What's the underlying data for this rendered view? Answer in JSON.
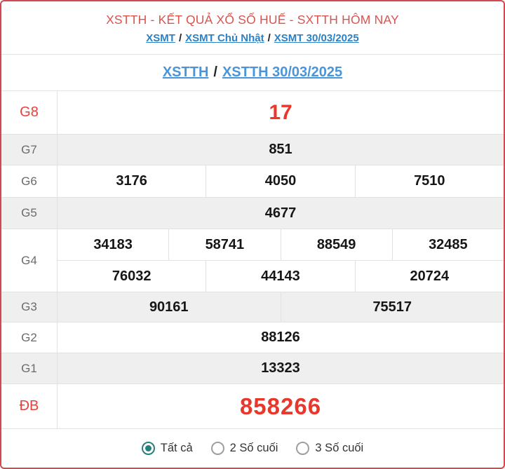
{
  "header": {
    "title": "XSTTH - KẾT QUẢ XỔ SỐ HUẾ - SXTTH HÔM NAY",
    "separator": "/",
    "breadcrumb": [
      {
        "label": "XSMT"
      },
      {
        "label": "XSMT Chủ Nhật"
      },
      {
        "label": "XSMT 30/03/2025"
      }
    ]
  },
  "subheader": {
    "region_link": "XSTTH",
    "separator": "/",
    "date_link": "XSTTH 30/03/2025"
  },
  "results": {
    "g8": {
      "label": "G8",
      "values": [
        "17"
      ]
    },
    "g7": {
      "label": "G7",
      "values": [
        "851"
      ]
    },
    "g6": {
      "label": "G6",
      "values": [
        "3176",
        "4050",
        "7510"
      ]
    },
    "g5": {
      "label": "G5",
      "values": [
        "4677"
      ]
    },
    "g4": {
      "label": "G4",
      "row1": [
        "34183",
        "58741",
        "88549",
        "32485"
      ],
      "row2": [
        "76032",
        "44143",
        "20724"
      ]
    },
    "g3": {
      "label": "G3",
      "values": [
        "90161",
        "75517"
      ]
    },
    "g2": {
      "label": "G2",
      "values": [
        "88126"
      ]
    },
    "g1": {
      "label": "G1",
      "values": [
        "13323"
      ]
    },
    "db": {
      "label": "ĐB",
      "values": [
        "858266"
      ]
    }
  },
  "footer": {
    "options": [
      {
        "label": "Tất cả",
        "selected": true
      },
      {
        "label": "2 Số cuối",
        "selected": false
      },
      {
        "label": "3 Số cuối",
        "selected": false
      }
    ]
  },
  "colors": {
    "accent_red": "#e8382c",
    "border_red": "#d04a50",
    "title_red": "#d9534f",
    "link_blue": "#2d80c4",
    "subtitle_blue": "#4b94d8",
    "radio_teal": "#26807c",
    "row_alt_gray": "#efefef"
  }
}
